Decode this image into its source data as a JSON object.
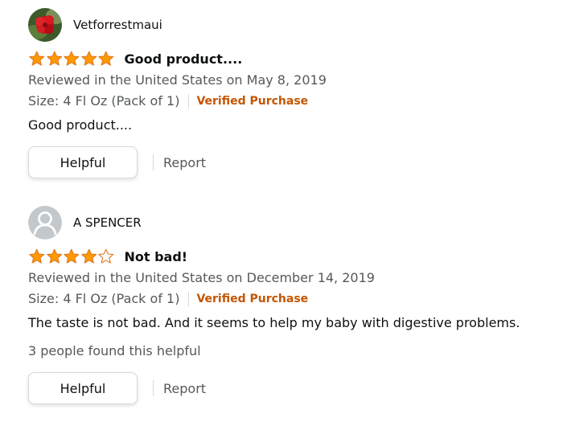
{
  "reviews": [
    {
      "profile_name": "Vetforrestmaui",
      "avatar_icon": "red-flower-photo",
      "rating": 5,
      "title": "Good product....",
      "date_line": "Reviewed in the United States on May 8, 2019",
      "format": "Size: 4 Fl Oz (Pack of 1)",
      "verified": "Verified Purchase",
      "body": "Good product....",
      "helpful_count": "",
      "helpful_label": "Helpful",
      "report_label": "Report"
    },
    {
      "profile_name": "A SPENCER",
      "avatar_icon": "default-user-icon",
      "rating": 4,
      "title": "Not bad!",
      "date_line": "Reviewed in the United States on December 14, 2019",
      "format": "Size: 4 Fl Oz (Pack of 1)",
      "verified": "Verified Purchase",
      "body": "The taste is not bad. And it seems to help my baby with digestive problems.",
      "helpful_count": "3 people found this helpful",
      "helpful_label": "Helpful",
      "report_label": "Report"
    }
  ],
  "colors": {
    "star_fill": "#ff9900",
    "star_stroke": "#de7921",
    "verified": "#c45500",
    "secondary_text": "#565959"
  }
}
